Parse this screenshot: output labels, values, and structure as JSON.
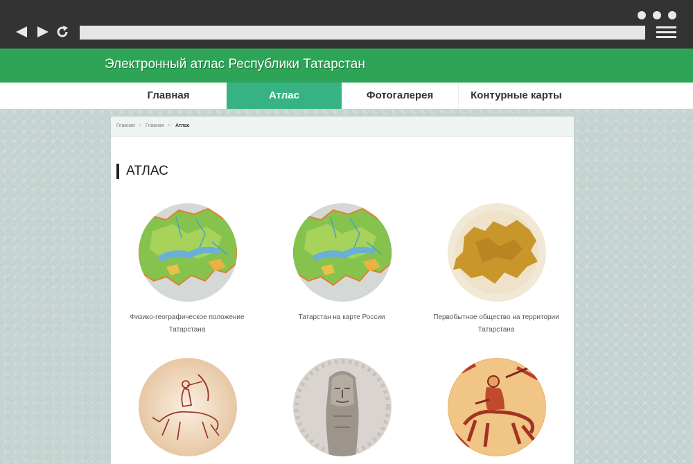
{
  "site": {
    "title": "Электронный атлас Республики Татарстан"
  },
  "menu": {
    "items": [
      {
        "label": "Главная"
      },
      {
        "label": "Атлас",
        "active": true
      },
      {
        "label": "Фотогалерея"
      },
      {
        "label": "Контурные карты"
      }
    ]
  },
  "breadcrumb": {
    "items": [
      "Главная",
      "Главная",
      "Атлас"
    ],
    "separator": ">"
  },
  "page": {
    "title": "АТЛАС"
  },
  "atlas_items": [
    {
      "caption": "Физико-географическое положение Татарстана",
      "icon": "physical-map-image"
    },
    {
      "caption": "Татарстан на карте России",
      "icon": "physical-map-image"
    },
    {
      "caption": "Первобытное общество на территории Татарстана",
      "icon": "ancient-map-image"
    },
    {
      "caption": "",
      "icon": "horse-archer-drawing-image"
    },
    {
      "caption": "",
      "icon": "stone-idol-image"
    },
    {
      "caption": "",
      "icon": "horseman-fresco-image"
    }
  ],
  "colors": {
    "header_green": "#2ea556",
    "active_tab": "#36b283",
    "chrome_dark": "#333333"
  }
}
